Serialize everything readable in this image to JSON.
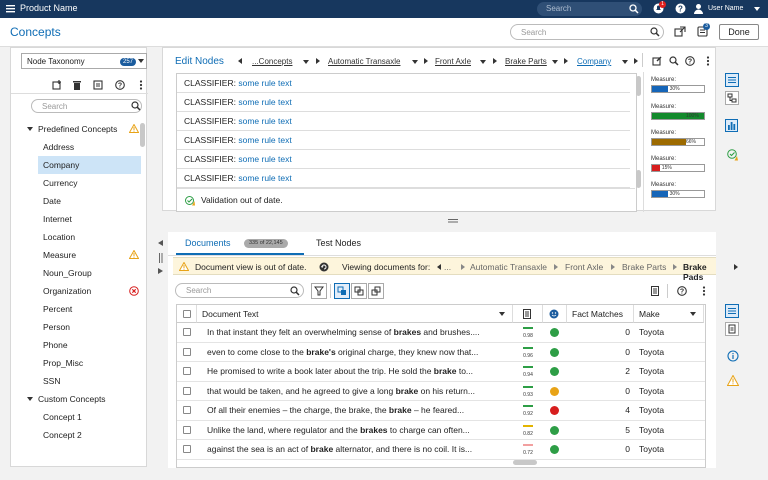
{
  "app": {
    "product_name": "Product Name",
    "notif_count": "1",
    "user_name": "User Name"
  },
  "top_search": {
    "placeholder": "Search"
  },
  "header": {
    "title": "Concepts",
    "search_placeholder": "Search",
    "msg_count": "3",
    "done_label": "Done"
  },
  "left": {
    "taxonomy_label": "Node Taxonomy",
    "taxonomy_count": "257",
    "search_placeholder": "Search",
    "predefined_label": "Predefined Concepts",
    "predefined_items": [
      "Address",
      "Company",
      "Currency",
      "Date",
      "Internet",
      "Location",
      "Measure",
      "Noun_Group",
      "Organization",
      "Percent",
      "Person",
      "Phone",
      "Prop_Misc",
      "SSN"
    ],
    "custom_label": "Custom Concepts",
    "custom_items": [
      "Concept 1",
      "Concept 2"
    ]
  },
  "edit": {
    "title": "Edit Nodes",
    "breadcrumbs": [
      "...Concepts",
      "Automatic Transaxle",
      "Front Axle",
      "Brake Parts",
      "Company"
    ],
    "rules": [
      {
        "prefix": "CLASSIFIER:",
        "text": "some rule text"
      },
      {
        "prefix": "CLASSIFIER:",
        "text": "some rule text"
      },
      {
        "prefix": "CLASSIFIER:",
        "text": "some rule text"
      },
      {
        "prefix": "CLASSIFIER:",
        "text": "some rule text"
      },
      {
        "prefix": "CLASSIFIER:",
        "text": "some rule text"
      },
      {
        "prefix": "CLASSIFIER:",
        "text": "some rule text"
      }
    ],
    "validation": "Validation out of date.",
    "measures": [
      {
        "label": "Measure:",
        "pct": "30%",
        "value": 30,
        "color": "#1565b8"
      },
      {
        "label": "Measure:",
        "pct": "100%",
        "value": 100,
        "color": "#138a2c"
      },
      {
        "label": "Measure:",
        "pct": "66%",
        "value": 66,
        "color": "#9c6a00"
      },
      {
        "label": "Measure:",
        "pct": "15%",
        "value": 15,
        "color": "#d71e1e"
      },
      {
        "label": "Measure:",
        "pct": "30%",
        "value": 30,
        "color": "#1565b8"
      }
    ]
  },
  "docs": {
    "tab_documents": "Documents",
    "doc_count": "335 of 22,145",
    "tab_test": "Test Nodes",
    "warning": "Document view is out of date.",
    "viewing_label": "Viewing documents for:",
    "viewing_path": [
      "...",
      "Automatic Transaxle",
      "Front Axle",
      "Brake Parts"
    ],
    "viewing_current": "Brake Pads",
    "search_placeholder": "Search",
    "col_text": "Document Text",
    "col_facts": "Fact Matches",
    "col_make": "Make",
    "rows": [
      {
        "pre": "In that instant they felt an overwhelming sense of ",
        "b": "brakes",
        "post": " and brushes....",
        "score": "0.98",
        "facts": "0",
        "make": "Toyota",
        "sent": "pos",
        "bar": "#2e9e46"
      },
      {
        "pre": "even to come close to the ",
        "b": "brake's",
        "post": " original charge, they knew now that...",
        "score": "0.96",
        "facts": "0",
        "make": "Toyota",
        "sent": "pos",
        "bar": "#2e9e46"
      },
      {
        "pre": "He promised to write a book later about the trip.  He sold the ",
        "b": "brake",
        "post": " to...",
        "score": "0.94",
        "facts": "2",
        "make": "Toyota",
        "sent": "pos",
        "bar": "#2e9e46"
      },
      {
        "pre": "that would be taken, and he agreed to give a long ",
        "b": "brake",
        "post": " on his return...",
        "score": "0.93",
        "facts": "0",
        "make": "Toyota",
        "sent": "neu",
        "bar": "#2e9e46"
      },
      {
        "pre": "Of all their enemies – the charge, the brake, the ",
        "b": "brake",
        "post": " – he feared...",
        "score": "0.92",
        "facts": "4",
        "make": "Toyota",
        "sent": "neg",
        "bar": "#2e9e46"
      },
      {
        "pre": "Unlike the land, where regulator and the ",
        "b": "brakes",
        "post": " to charge can often...",
        "score": "0.82",
        "facts": "5",
        "make": "Toyota",
        "sent": "pos",
        "bar": "#e3b400"
      },
      {
        "pre": "against the sea is an act of ",
        "b": "brake",
        "post": " alternator, and there is no coil.  It is...",
        "score": "0.72",
        "facts": "0",
        "make": "Toyota",
        "sent": "pos",
        "bar": "#f2a0a0"
      }
    ]
  },
  "colors": {
    "brand": "#17375e",
    "accent": "#0f6db5",
    "positive": "#2e9e46",
    "neutral": "#e8a317",
    "negative": "#d71e1e"
  }
}
